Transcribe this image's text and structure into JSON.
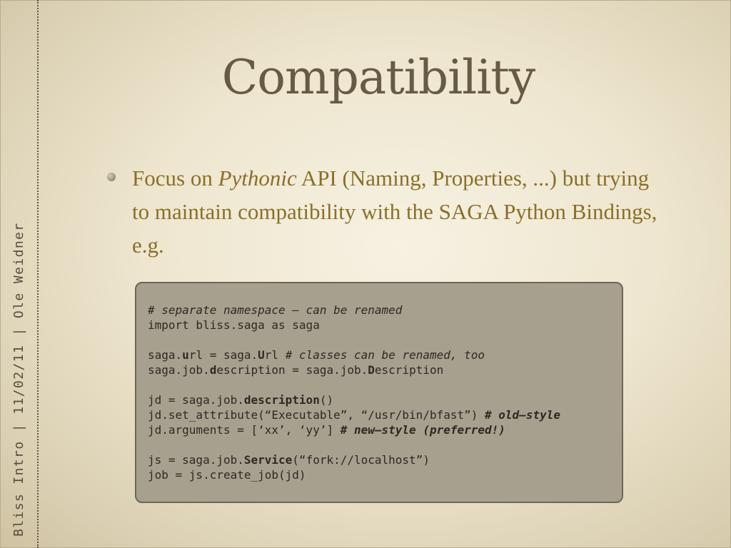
{
  "sidebar": {
    "text": "Bliss Intro | 11/02/11 | Ole Weidner"
  },
  "slide": {
    "title": "Compatibility",
    "bullet": {
      "part1": "Focus on ",
      "italic": "Pythonic",
      "part2": " API (Naming, Properties, ...) but trying to maintain compatibility with the SAGA Python Bindings, e.g."
    }
  },
  "code": {
    "l1": "# separate namespace – can be renamed",
    "l2": "import bliss.saga as saga",
    "l3a": "saga.",
    "l3b": "u",
    "l3c": "rl = saga.",
    "l3d": "U",
    "l3e": "rl ",
    "l3f": "# classes can be renamed, too",
    "l4a": "saga.job.",
    "l4b": "d",
    "l4c": "escription = saga.job.",
    "l4d": "D",
    "l4e": "escription",
    "l5a": "jd = saga.job.",
    "l5b": "description",
    "l5c": "()",
    "l6a": "jd.set_attribute(“Executable”, “/usr/bin/bfast”) ",
    "l6b": "# old–style",
    "l7a": "jd.arguments = [‘xx’, ‘yy’] ",
    "l7b": "# new–style (preferred!)",
    "l8a": "js = saga.job.",
    "l8b": "Service",
    "l8c": "(“fork://localhost”)",
    "l9": "job = js.create_job(jd)"
  }
}
